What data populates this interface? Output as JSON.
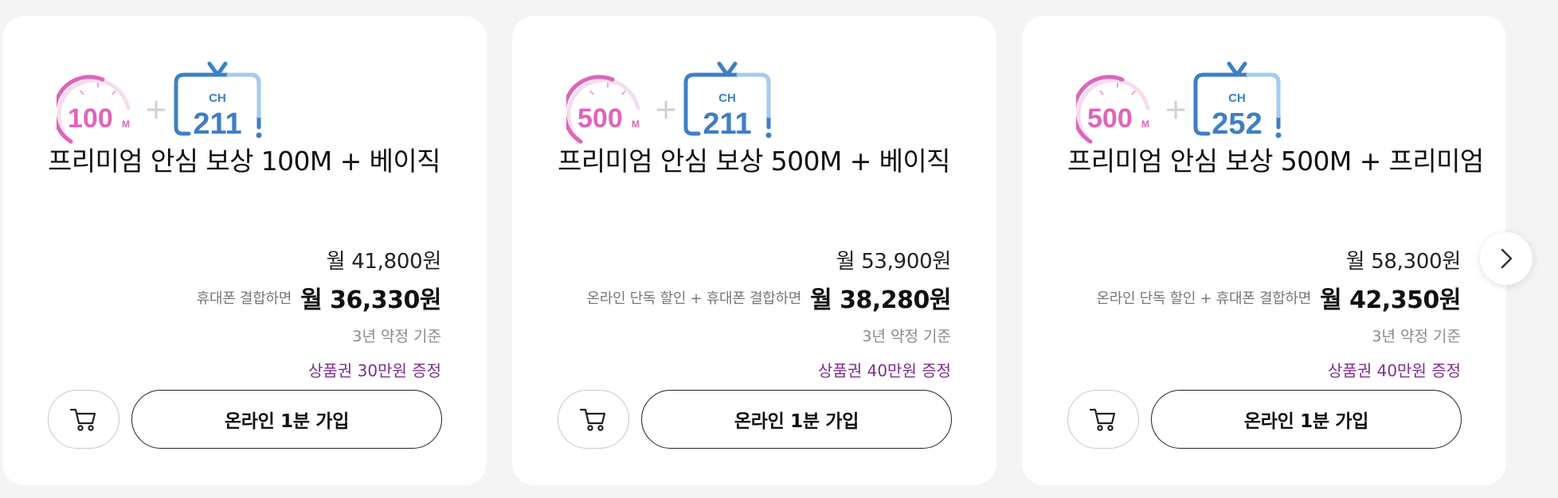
{
  "cards": [
    {
      "speed_value": "100",
      "speed_unit": "M",
      "tv_prefix": "CH",
      "tv_channels": "211",
      "title": "프리미엄 안심 보상 100M + 베이직",
      "price": "월 41,800원",
      "discount_condition": "휴대폰 결합하면",
      "discount_price": "월 36,330원",
      "term": "3년 약정 기준",
      "gift": "상품권 30만원 증정",
      "join_label": "온라인 1분 가입",
      "cart_icon": "cart-icon"
    },
    {
      "speed_value": "500",
      "speed_unit": "M",
      "tv_prefix": "CH",
      "tv_channels": "211",
      "title": "프리미엄 안심 보상 500M + 베이직",
      "price": "월 53,900원",
      "discount_condition": "온라인 단독 할인 + 휴대폰 결합하면",
      "discount_price": "월 38,280원",
      "term": "3년 약정 기준",
      "gift": "상품권 40만원 증정",
      "join_label": "온라인 1분 가입",
      "cart_icon": "cart-icon"
    },
    {
      "speed_value": "500",
      "speed_unit": "M",
      "tv_prefix": "CH",
      "tv_channels": "252",
      "title": "프리미엄 안심 보상 500M + 프리미엄",
      "price": "월 58,300원",
      "discount_condition": "온라인 단독 할인 + 휴대폰 결합하면",
      "discount_price": "월 42,350원",
      "term": "3년 약정 기준",
      "gift": "상품권 40만원 증정",
      "join_label": "온라인 1분 가입",
      "cart_icon": "cart-icon"
    }
  ],
  "carousel": {
    "next_icon": "chevron-right-icon"
  },
  "colors": {
    "background": "#f4f4f5",
    "speed_pink": "#e064b8",
    "tv_blue": "#3f7fc4",
    "gift_purple": "#7b2f8e"
  }
}
